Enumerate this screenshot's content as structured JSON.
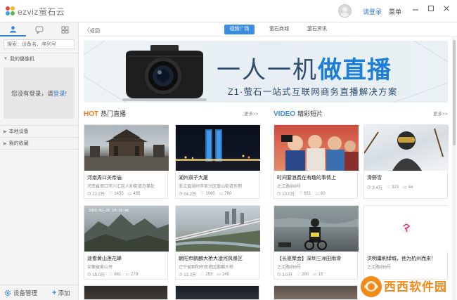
{
  "app": {
    "logo_text": "ezviz萤石云",
    "login_label": "请登录",
    "menu_label": "菜单"
  },
  "sidebar": {
    "search_placeholder": "搜索：设备名、序列号",
    "groups": {
      "my_cameras": "我的摄像机",
      "local_devices": "本地设备",
      "favorites": "我的收藏"
    },
    "empty_text_prefix": "您没有登录，请",
    "empty_text_link": "登录",
    "empty_text_suffix": "!",
    "device_manage_label": "设备管理",
    "add_label": "添加"
  },
  "topnav": {
    "back_label": "返回",
    "tabs": [
      {
        "label": "视频广场",
        "active": true
      },
      {
        "label": "萤石商城",
        "active": false
      },
      {
        "label": "萤石资讯",
        "active": false
      }
    ]
  },
  "banner": {
    "headline_light": "一人一机",
    "headline_bold": "做直播",
    "subline": "Z1·萤石一站式互联网商务直播解决方案"
  },
  "sections": {
    "hot": {
      "tag": "HOT",
      "title": "热门直播",
      "more": "更多>>"
    },
    "video": {
      "tag": "VIDEO",
      "title": "精彩短片",
      "more": "更多>>"
    }
  },
  "hot_cards": [
    {
      "title": "河南周口关帝庙",
      "subtitle": "河南省周口市川汇区人和街道办事处",
      "views": "22.2万",
      "likes": "1455",
      "comments": "495"
    },
    {
      "title": "湖州双子大厦",
      "subtitle": "浙江省湖州市吴兴区爱山街道东侧",
      "views": "24.2万",
      "likes": "1060",
      "comments": "700"
    },
    {
      "title": "遥看黄山莲花峰",
      "subtitle": "安徽省黄山市",
      "views": "15.0万",
      "likes": "661",
      "comments": "279"
    },
    {
      "title": "朝阳市鹏麟大桥大凌河风景区",
      "subtitle": "辽宁省朝阳市双塔区鹏麟大桥",
      "views": "12.3万",
      "likes": "253",
      "comments": "245"
    }
  ],
  "video_cards": [
    {
      "title": "时间要浪费在有趣的事情上",
      "subtitle": "之江路888号",
      "views": "10.0万",
      "likes": "651",
      "comments": "60"
    },
    {
      "title": "滑野雪",
      "subtitle": "",
      "views": "3.4万",
      "likes": "323",
      "comments": "44"
    },
    {
      "title": "【长驱聚会】深圳三洲田雨滑",
      "subtitle": "之江路888号",
      "views": "3.0万",
      "likes": "290",
      "comments": "15"
    },
    {
      "title": "洪明庸刷绿城，他为杭州而来！",
      "subtitle": "之江路888号",
      "views": "",
      "likes": "",
      "comments": ""
    }
  ],
  "thumb_overlay": {
    "timestamp": "2016-02-26 14:10:48"
  },
  "watermark": {
    "text": "西西软件园"
  },
  "colors": {
    "accent": "#3a8de0",
    "hot": "#f07a1a",
    "video": "#3a8de0",
    "link": "#3a7bd5"
  }
}
